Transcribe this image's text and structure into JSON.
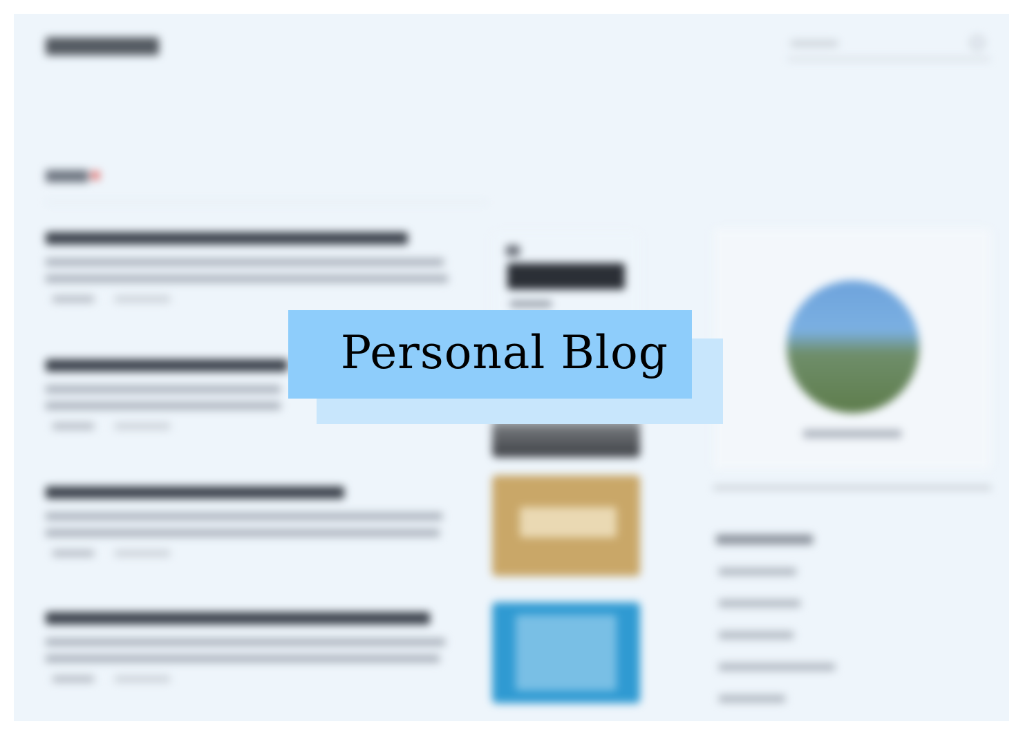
{
  "banner": {
    "title": "Personal Blog"
  },
  "colors": {
    "page_background": "#eef5fb",
    "banner_fill": "#8ecdfb",
    "banner_shadow": "#c8e6fc",
    "title_text": "#000000"
  },
  "icons": {
    "search": "search-icon"
  }
}
